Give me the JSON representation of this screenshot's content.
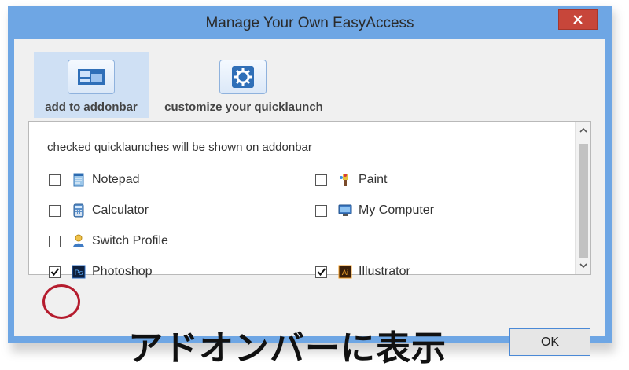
{
  "window": {
    "title": "Manage Your Own EasyAccess",
    "close_glyph": "✕",
    "accent_color": "#6ea6e4"
  },
  "toolbar": {
    "add_label": "add to addonbar",
    "add_icon": "window-layout-icon",
    "customize_label": "customize your quicklaunch",
    "customize_icon": "gear-icon"
  },
  "panel": {
    "info": "checked quicklaunches will be shown on addonbar",
    "items": [
      {
        "label": "Notepad",
        "checked": false,
        "icon": "notepad-icon"
      },
      {
        "label": "Paint",
        "checked": false,
        "icon": "paint-icon"
      },
      {
        "label": "Calculator",
        "checked": false,
        "icon": "calculator-icon"
      },
      {
        "label": "My Computer",
        "checked": false,
        "icon": "computer-icon"
      },
      {
        "label": "Switch Profile",
        "checked": false,
        "icon": "user-profile-icon"
      },
      {
        "label": "Photoshop",
        "checked": true,
        "icon": "photoshop-icon",
        "icon_text": "Ps"
      },
      {
        "label": "Illustrator",
        "checked": true,
        "icon": "illustrator-icon",
        "icon_text": "Ai"
      }
    ]
  },
  "annotation": {
    "caption": "アドオンバーに表示",
    "circle_color": "#b51c2e"
  },
  "buttons": {
    "ok": "OK"
  }
}
